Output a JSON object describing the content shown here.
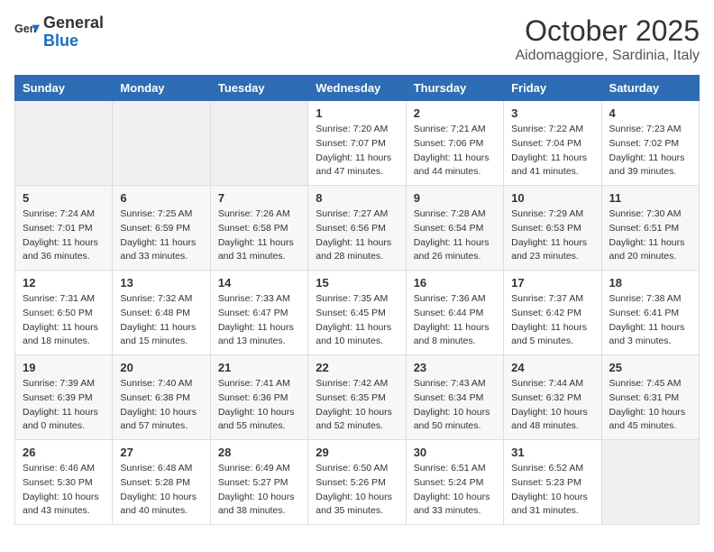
{
  "header": {
    "logo_general": "General",
    "logo_blue": "Blue",
    "month": "October 2025",
    "location": "Aidomaggiore, Sardinia, Italy"
  },
  "days_of_week": [
    "Sunday",
    "Monday",
    "Tuesday",
    "Wednesday",
    "Thursday",
    "Friday",
    "Saturday"
  ],
  "weeks": [
    [
      {
        "day": "",
        "info": ""
      },
      {
        "day": "",
        "info": ""
      },
      {
        "day": "",
        "info": ""
      },
      {
        "day": "1",
        "info": "Sunrise: 7:20 AM\nSunset: 7:07 PM\nDaylight: 11 hours and 47 minutes."
      },
      {
        "day": "2",
        "info": "Sunrise: 7:21 AM\nSunset: 7:06 PM\nDaylight: 11 hours and 44 minutes."
      },
      {
        "day": "3",
        "info": "Sunrise: 7:22 AM\nSunset: 7:04 PM\nDaylight: 11 hours and 41 minutes."
      },
      {
        "day": "4",
        "info": "Sunrise: 7:23 AM\nSunset: 7:02 PM\nDaylight: 11 hours and 39 minutes."
      }
    ],
    [
      {
        "day": "5",
        "info": "Sunrise: 7:24 AM\nSunset: 7:01 PM\nDaylight: 11 hours and 36 minutes."
      },
      {
        "day": "6",
        "info": "Sunrise: 7:25 AM\nSunset: 6:59 PM\nDaylight: 11 hours and 33 minutes."
      },
      {
        "day": "7",
        "info": "Sunrise: 7:26 AM\nSunset: 6:58 PM\nDaylight: 11 hours and 31 minutes."
      },
      {
        "day": "8",
        "info": "Sunrise: 7:27 AM\nSunset: 6:56 PM\nDaylight: 11 hours and 28 minutes."
      },
      {
        "day": "9",
        "info": "Sunrise: 7:28 AM\nSunset: 6:54 PM\nDaylight: 11 hours and 26 minutes."
      },
      {
        "day": "10",
        "info": "Sunrise: 7:29 AM\nSunset: 6:53 PM\nDaylight: 11 hours and 23 minutes."
      },
      {
        "day": "11",
        "info": "Sunrise: 7:30 AM\nSunset: 6:51 PM\nDaylight: 11 hours and 20 minutes."
      }
    ],
    [
      {
        "day": "12",
        "info": "Sunrise: 7:31 AM\nSunset: 6:50 PM\nDaylight: 11 hours and 18 minutes."
      },
      {
        "day": "13",
        "info": "Sunrise: 7:32 AM\nSunset: 6:48 PM\nDaylight: 11 hours and 15 minutes."
      },
      {
        "day": "14",
        "info": "Sunrise: 7:33 AM\nSunset: 6:47 PM\nDaylight: 11 hours and 13 minutes."
      },
      {
        "day": "15",
        "info": "Sunrise: 7:35 AM\nSunset: 6:45 PM\nDaylight: 11 hours and 10 minutes."
      },
      {
        "day": "16",
        "info": "Sunrise: 7:36 AM\nSunset: 6:44 PM\nDaylight: 11 hours and 8 minutes."
      },
      {
        "day": "17",
        "info": "Sunrise: 7:37 AM\nSunset: 6:42 PM\nDaylight: 11 hours and 5 minutes."
      },
      {
        "day": "18",
        "info": "Sunrise: 7:38 AM\nSunset: 6:41 PM\nDaylight: 11 hours and 3 minutes."
      }
    ],
    [
      {
        "day": "19",
        "info": "Sunrise: 7:39 AM\nSunset: 6:39 PM\nDaylight: 11 hours and 0 minutes."
      },
      {
        "day": "20",
        "info": "Sunrise: 7:40 AM\nSunset: 6:38 PM\nDaylight: 10 hours and 57 minutes."
      },
      {
        "day": "21",
        "info": "Sunrise: 7:41 AM\nSunset: 6:36 PM\nDaylight: 10 hours and 55 minutes."
      },
      {
        "day": "22",
        "info": "Sunrise: 7:42 AM\nSunset: 6:35 PM\nDaylight: 10 hours and 52 minutes."
      },
      {
        "day": "23",
        "info": "Sunrise: 7:43 AM\nSunset: 6:34 PM\nDaylight: 10 hours and 50 minutes."
      },
      {
        "day": "24",
        "info": "Sunrise: 7:44 AM\nSunset: 6:32 PM\nDaylight: 10 hours and 48 minutes."
      },
      {
        "day": "25",
        "info": "Sunrise: 7:45 AM\nSunset: 6:31 PM\nDaylight: 10 hours and 45 minutes."
      }
    ],
    [
      {
        "day": "26",
        "info": "Sunrise: 6:46 AM\nSunset: 5:30 PM\nDaylight: 10 hours and 43 minutes."
      },
      {
        "day": "27",
        "info": "Sunrise: 6:48 AM\nSunset: 5:28 PM\nDaylight: 10 hours and 40 minutes."
      },
      {
        "day": "28",
        "info": "Sunrise: 6:49 AM\nSunset: 5:27 PM\nDaylight: 10 hours and 38 minutes."
      },
      {
        "day": "29",
        "info": "Sunrise: 6:50 AM\nSunset: 5:26 PM\nDaylight: 10 hours and 35 minutes."
      },
      {
        "day": "30",
        "info": "Sunrise: 6:51 AM\nSunset: 5:24 PM\nDaylight: 10 hours and 33 minutes."
      },
      {
        "day": "31",
        "info": "Sunrise: 6:52 AM\nSunset: 5:23 PM\nDaylight: 10 hours and 31 minutes."
      },
      {
        "day": "",
        "info": ""
      }
    ]
  ]
}
